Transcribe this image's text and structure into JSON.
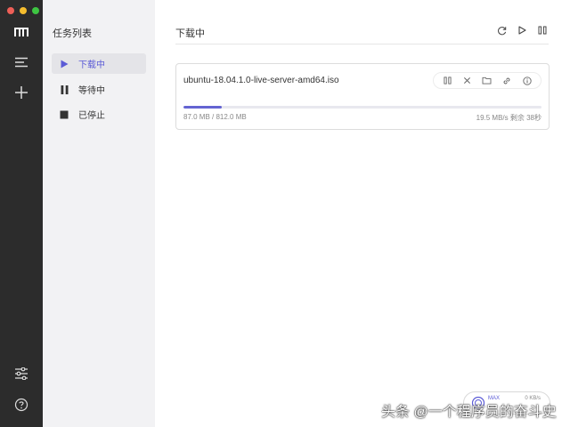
{
  "window": {
    "traffic_lights": {
      "close": "#ee5f57",
      "minimize": "#f5bd2e",
      "zoom": "#3ec542"
    }
  },
  "rail": {
    "items": [
      {
        "icon": "logo-icon"
      },
      {
        "icon": "menu-icon"
      },
      {
        "icon": "plus-icon"
      },
      {
        "icon": "settings-sliders-icon"
      },
      {
        "icon": "help-icon"
      }
    ]
  },
  "sidebar": {
    "title": "任务列表",
    "items": [
      {
        "label": "下载中",
        "icon": "play-icon",
        "active": true
      },
      {
        "label": "等待中",
        "icon": "pause-icon",
        "active": false
      },
      {
        "label": "已停止",
        "icon": "stop-icon",
        "active": false
      }
    ]
  },
  "main": {
    "title": "下载中",
    "header_actions": [
      "refresh-icon",
      "play-icon",
      "pause-icon"
    ],
    "tasks": [
      {
        "name": "ubuntu-18.04.1.0-live-server-amd64.iso",
        "size": "87.0 MB / 812.0 MB",
        "speed": "19.5 MB/s 剩余 38秒",
        "progress": 0.107
      }
    ]
  },
  "speed_widget": {
    "max_label": "MAX",
    "speed": "0 KB/s"
  },
  "watermark": "头条 @一个程序员的奋斗史",
  "colors": {
    "accent": "#5b5bd6",
    "rail_bg": "#2c2c2c",
    "sidebar_bg": "#f2f2f4"
  }
}
